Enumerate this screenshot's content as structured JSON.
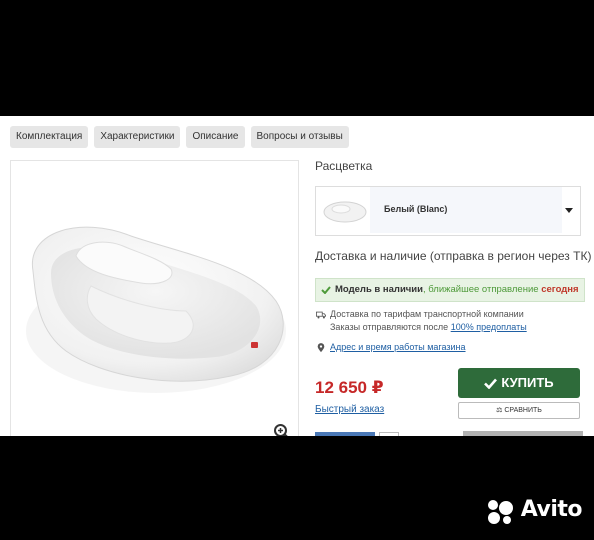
{
  "tabs": [
    "Комплектация",
    "Характеристики",
    "Описание",
    "Вопросы и отзывы"
  ],
  "color": {
    "title": "Расцветка",
    "selected_name": "Белый (Blanc)"
  },
  "delivery": {
    "title": "Доставка и наличие (отправка в регион через ТК)",
    "stock_model": "Модель в наличии",
    "stock_next": ", ближайшее отправление ",
    "stock_when": "сегодня",
    "shipping_line1": "Доставка по тарифам транспортной компании",
    "shipping_line2_prefix": "Заказы отправляются после ",
    "shipping_line2_link": "100% предоплаты",
    "store_link": "Адрес и время работы магазина"
  },
  "price": "12 650 ₽",
  "quick_order": "Быстрый заказ",
  "buy_label": "КУПИТЬ",
  "compare_label": "СРАВНИТЬ",
  "watermark": "Avito",
  "colors": {
    "buy": "#2e6b3a",
    "price": "#c62828",
    "link": "#1f5fa3",
    "stock_bg": "#e8f3e4"
  }
}
